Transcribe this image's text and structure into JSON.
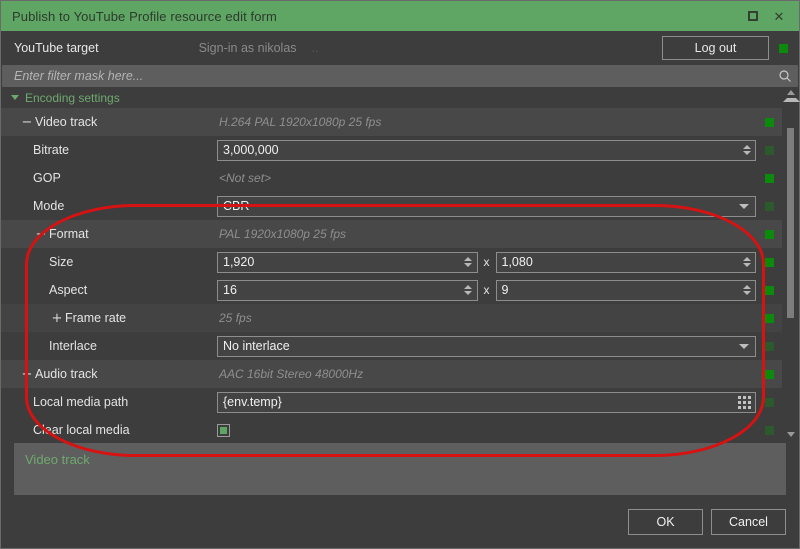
{
  "window": {
    "title": "Publish to YouTube Profile resource edit form",
    "maximize_icon": "maximize-icon",
    "close_icon": "close-icon",
    "close_glyph": "✕"
  },
  "target": {
    "label": "YouTube target",
    "signin_text": "Sign-in as nikolas",
    "signin_dots": "..",
    "logout_label": "Log out"
  },
  "filter": {
    "placeholder": "Enter filter mask here...",
    "icon": "search-icon"
  },
  "grid": {
    "header": "Encoding settings",
    "rows": [
      {
        "name": "video-track",
        "label": "Video track",
        "expander": "−",
        "summary": "H.264 PAL 1920x1080p 25 fps",
        "kind": "group",
        "indent": 0,
        "indicator": "bright"
      },
      {
        "name": "bitrate",
        "label": "Bitrate",
        "value": "3,000,000",
        "kind": "spinner",
        "indent": 1,
        "indicator": "dim"
      },
      {
        "name": "gop",
        "label": "GOP",
        "summary": "<Not set>",
        "kind": "readonly",
        "indent": 1,
        "indicator": "bright"
      },
      {
        "name": "mode",
        "label": "Mode",
        "value": "CBR",
        "kind": "combo",
        "indent": 1,
        "indicator": "dim"
      },
      {
        "name": "format",
        "label": "Format",
        "expander": "−",
        "summary": "PAL 1920x1080p 25 fps",
        "kind": "group",
        "indent": 1,
        "indicator": "bright"
      },
      {
        "name": "size",
        "label": "Size",
        "value": "1,920",
        "value2": "1,080",
        "separator": "x",
        "kind": "pair-spinner",
        "indent": 2,
        "indicator": "bright"
      },
      {
        "name": "aspect",
        "label": "Aspect",
        "value": "16",
        "value2": "9",
        "separator": "x",
        "kind": "pair-spinner",
        "indent": 2,
        "indicator": "bright"
      },
      {
        "name": "frame-rate",
        "label": "Frame rate",
        "expander": "+",
        "summary": "25 fps",
        "kind": "subgroup",
        "indent": 2,
        "indicator": "bright"
      },
      {
        "name": "interlace",
        "label": "Interlace",
        "value": "No interlace",
        "kind": "combo",
        "indent": 2,
        "indicator": "dim"
      },
      {
        "name": "audio-track",
        "label": "Audio track",
        "expander": "+",
        "summary": "AAC 16bit Stereo 48000Hz",
        "kind": "group",
        "indent": 0,
        "indicator": "bright"
      },
      {
        "name": "local-media-path",
        "label": "Local media path",
        "value": "{env.temp}",
        "kind": "browse",
        "indent": 1,
        "indicator": "dim"
      },
      {
        "name": "clear-local-media",
        "label": "Clear local media",
        "kind": "checkbox",
        "checked": true,
        "indent": 1,
        "indicator": "dim"
      }
    ]
  },
  "description": {
    "title": "Video track"
  },
  "footer": {
    "ok_label": "OK",
    "cancel_label": "Cancel"
  },
  "colors": {
    "title_bar": "#5fa564",
    "accent_green": "#6fa86f",
    "indicator_on": "#0b8a0b",
    "indicator_dim": "#2d5a2d",
    "annotation": "#d61212",
    "window_bg": "#3d3d3d"
  }
}
